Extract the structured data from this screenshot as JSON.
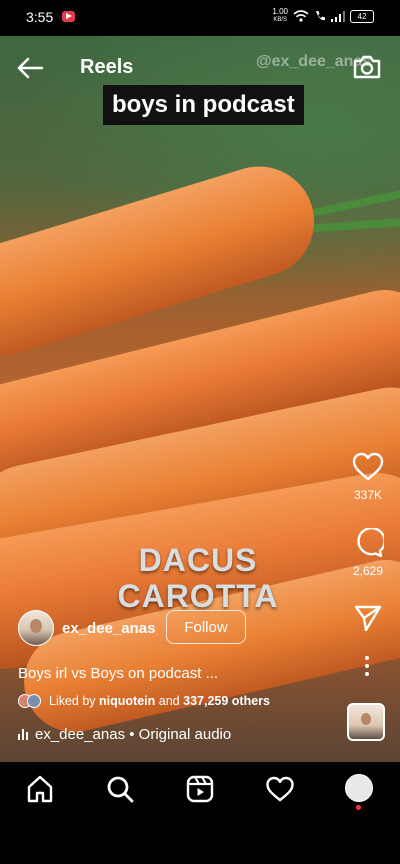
{
  "status_bar": {
    "time": "3:55",
    "net_speed_value": "1.00",
    "net_speed_unit": "KB/S",
    "battery": "42"
  },
  "header": {
    "title": "Reels",
    "watermark": "@ex_dee_anas"
  },
  "video": {
    "caption": "boys in podcast",
    "overlay_line1": "DACUS",
    "overlay_line2": "CAROTTA"
  },
  "actions": {
    "likes": "337K",
    "comments": "2,629"
  },
  "author": {
    "username": "ex_dee_anas",
    "follow_label": "Follow"
  },
  "post": {
    "description": "Boys irl vs Boys on podcast ...",
    "liked_by_prefix": "Liked by",
    "liked_by_user": "niquotein",
    "liked_by_and": "and",
    "liked_by_others": "337,259 others",
    "audio": "ex_dee_anas • Original audio"
  },
  "icons": {
    "back": "back-arrow-icon",
    "camera": "camera-icon",
    "like": "heart-icon",
    "comment": "comment-icon",
    "share": "send-icon",
    "more": "more-vertical-icon",
    "home": "home-icon",
    "search": "search-icon",
    "reels": "reels-icon",
    "activity": "heart-icon",
    "profile": "profile-avatar"
  },
  "colors": {
    "notification_dot": "#ff3040",
    "app_badge": "#e53950"
  }
}
